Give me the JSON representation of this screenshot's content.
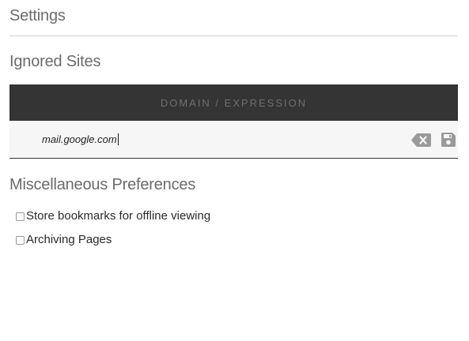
{
  "page": {
    "title": "Settings"
  },
  "ignored_sites": {
    "title": "Ignored Sites",
    "column_header": "DOMAIN / EXPRESSION",
    "rows": [
      {
        "value": "mail.google.com"
      }
    ],
    "icons": {
      "delete": "backspace-delete-icon",
      "save": "floppy-save-icon"
    }
  },
  "misc": {
    "title": "Miscellaneous Preferences",
    "preferences": [
      {
        "label": "Store bookmarks for offline viewing",
        "checked": false
      },
      {
        "label": "Archiving Pages",
        "checked": false
      }
    ]
  },
  "colors": {
    "header_bg": "#343434",
    "header_text": "#6f6f6f",
    "row_bg": "#f6f6f6",
    "icon": "#9a9a9a",
    "heading": "#6b6b6b"
  }
}
